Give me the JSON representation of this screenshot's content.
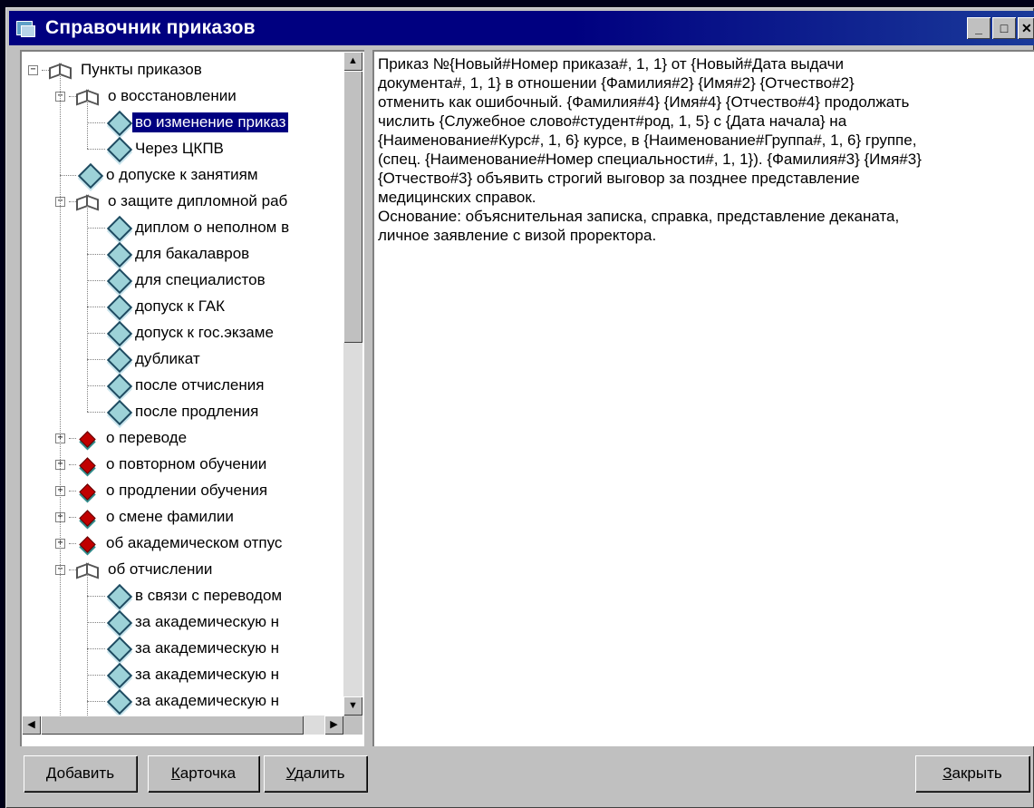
{
  "window": {
    "title": "Справочник приказов",
    "buttons": {
      "minimize": "_",
      "maximize": "□",
      "close": "✕"
    }
  },
  "tree": {
    "nodes": [
      {
        "label": "Пункты приказов",
        "level": 0,
        "icon": "open-book-icon",
        "expander": "minus",
        "selected": false
      },
      {
        "label": "о восстановлении",
        "level": 1,
        "icon": "open-book-icon",
        "expander": "minus",
        "selected": false
      },
      {
        "label": "во изменение приказ",
        "level": 2,
        "icon": "leaf-page-icon",
        "expander": "",
        "selected": true
      },
      {
        "label": "Через ЦКПВ",
        "level": 2,
        "icon": "leaf-page-icon",
        "expander": "",
        "selected": false
      },
      {
        "label": "о допуске к занятиям",
        "level": 1,
        "icon": "leaf-page-icon",
        "expander": "",
        "selected": false
      },
      {
        "label": "о защите дипломной раб",
        "level": 1,
        "icon": "open-book-icon",
        "expander": "minus",
        "selected": false
      },
      {
        "label": "диплом о неполном в",
        "level": 2,
        "icon": "leaf-page-icon",
        "expander": "",
        "selected": false
      },
      {
        "label": "для бакалавров",
        "level": 2,
        "icon": "leaf-page-icon",
        "expander": "",
        "selected": false
      },
      {
        "label": "для специалистов",
        "level": 2,
        "icon": "leaf-page-icon",
        "expander": "",
        "selected": false
      },
      {
        "label": "допуск к ГАК",
        "level": 2,
        "icon": "leaf-page-icon",
        "expander": "",
        "selected": false
      },
      {
        "label": "допуск к гос.экзаме",
        "level": 2,
        "icon": "leaf-page-icon",
        "expander": "",
        "selected": false
      },
      {
        "label": "дубликат",
        "level": 2,
        "icon": "leaf-page-icon",
        "expander": "",
        "selected": false
      },
      {
        "label": "после отчисления",
        "level": 2,
        "icon": "leaf-page-icon",
        "expander": "",
        "selected": false
      },
      {
        "label": "после продления",
        "level": 2,
        "icon": "leaf-page-icon",
        "expander": "",
        "selected": false
      },
      {
        "label": "о переводе",
        "level": 1,
        "icon": "closed-book-icon",
        "expander": "plus",
        "selected": false
      },
      {
        "label": "о повторном обучении",
        "level": 1,
        "icon": "closed-book-icon",
        "expander": "plus",
        "selected": false
      },
      {
        "label": "о продлении обучения",
        "level": 1,
        "icon": "closed-book-icon",
        "expander": "plus",
        "selected": false
      },
      {
        "label": "о смене фамилии",
        "level": 1,
        "icon": "closed-book-icon",
        "expander": "plus",
        "selected": false
      },
      {
        "label": "об академическом отпус",
        "level": 1,
        "icon": "closed-book-icon",
        "expander": "plus",
        "selected": false
      },
      {
        "label": "об отчислении",
        "level": 1,
        "icon": "open-book-icon",
        "expander": "minus",
        "selected": false
      },
      {
        "label": "в связи с переводом",
        "level": 2,
        "icon": "leaf-page-icon",
        "expander": "",
        "selected": false
      },
      {
        "label": "за академическую н",
        "level": 2,
        "icon": "leaf-page-icon",
        "expander": "",
        "selected": false
      },
      {
        "label": "за академическую н",
        "level": 2,
        "icon": "leaf-page-icon",
        "expander": "",
        "selected": false
      },
      {
        "label": "за академическую н",
        "level": 2,
        "icon": "leaf-page-icon",
        "expander": "",
        "selected": false
      },
      {
        "label": "за академическую н",
        "level": 2,
        "icon": "leaf-page-icon",
        "expander": "",
        "selected": false
      }
    ],
    "scroll": {
      "up": "▲",
      "down": "▼",
      "left": "◀",
      "right": "▶"
    }
  },
  "text": {
    "lines": [
      "Приказ №{Новый#Номер приказа#, 1, 1} от {Новый#Дата выдачи",
      "документа#, 1, 1} в отношении {Фамилия#2} {Имя#2} {Отчество#2}",
      "отменить как ошибочный. {Фамилия#4} {Имя#4} {Отчество#4} продолжать",
      "числить {Служебное слово#студент#род, 1, 5} с {Дата начала} на",
      "{Наименование#Курс#, 1, 6} курсе, в {Наименование#Группа#, 1, 6} группе,",
      "(спец. {Наименование#Номер специальности#, 1, 1}). {Фамилия#3} {Имя#3}",
      "{Отчество#3} объявить строгий выговор за позднее представление",
      "медицинских справок.",
      "Основание: объяснительная записка, справка, представление деканата,",
      "личное заявление с визой проректора."
    ]
  },
  "buttons": {
    "add": "Добавить",
    "card": "Карточка",
    "delete": "Удалить",
    "close": "Закрыть"
  }
}
